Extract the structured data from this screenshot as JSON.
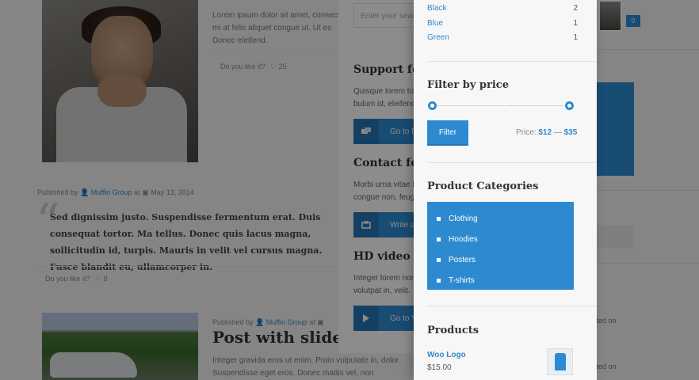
{
  "background": {
    "post1": {
      "excerpt_lines": [
        "Lorem ipsum dolor sit amet, consectet",
        "mi at felis aliquet congue ut. Ut es",
        "Donec eleifend."
      ],
      "like_label": "Do you like it?",
      "like_count": "25"
    },
    "post2": {
      "meta_prefix": "Published by",
      "author": "Muffin Group",
      "at": "at",
      "date": "May 13, 2014",
      "quote": "Sed dignissim justo. Suspendisse fermentum erat. Duis consequat tortor. Ma tellus. Donec quis lacus magna, sollicitudin id, turpis. Mauris in velit vel cursus magna. Fusce blandit eu, ullamcorper in.",
      "like_label": "Do you like it?",
      "like_count": "8"
    },
    "post3": {
      "meta_prefix": "Published by",
      "author": "Muffin Group",
      "at": "at",
      "title": "Post with slideshow",
      "excerpt_lines": [
        "Integer gravida eros ut enim. Proin vulputate in, dolor",
        "Suspendisse eget eros. Donec mattis vel, non"
      ]
    },
    "right": {
      "cart_count": "0",
      "comment_1": "mented on",
      "comment_2": "mented on"
    }
  },
  "middle": {
    "search_placeholder": "Enter your search",
    "support": {
      "title": "Support for",
      "text_lines": [
        "Quisque lorem tor",
        "bulum id, eleifend"
      ],
      "button": "Go to f"
    },
    "contact": {
      "title": "Contact for",
      "text_lines": [
        "Morbi urna vitae li",
        "congue non, feugi"
      ],
      "button": "Write u"
    },
    "video": {
      "title": "HD video tu",
      "text_lines": [
        "Integer lorem non",
        "volutpat in, velit."
      ],
      "button": "Go to Y"
    }
  },
  "sidebar": {
    "colors": [
      {
        "name": "Black",
        "count": "2"
      },
      {
        "name": "Blue",
        "count": "1"
      },
      {
        "name": "Green",
        "count": "1"
      }
    ],
    "price_filter": {
      "title": "Filter by price",
      "button": "Filter",
      "price_label": "Price:",
      "min": "$12",
      "dash": "—",
      "max": "$35"
    },
    "categories": {
      "title": "Product Categories",
      "items": [
        "Clothing",
        "Hoodies",
        "Posters",
        "T-shirts"
      ]
    },
    "products": {
      "title": "Products",
      "items": [
        {
          "name": "Woo Logo",
          "price": "$15.00"
        }
      ]
    }
  },
  "colors": {
    "accent": "#2e8ad0",
    "accent_dark": "#2677b4",
    "panel_bg": "#f7f7f7"
  }
}
